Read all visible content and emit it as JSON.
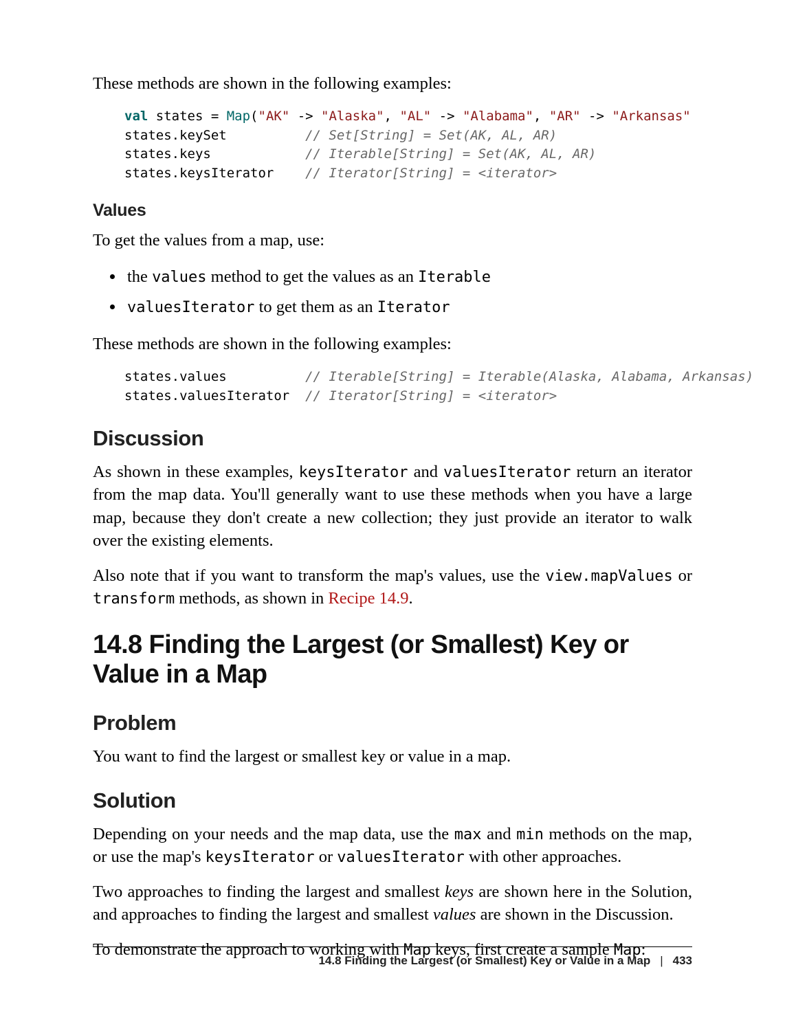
{
  "intro1": "These methods are shown in the following examples:",
  "code1": {
    "l1a": "val",
    "l1b": " states = ",
    "l1c": "Map",
    "l1d": "(",
    "l1s1": "\"AK\"",
    "l1e": " -> ",
    "l1s2": "\"Alaska\"",
    "l1f": ", ",
    "l1s3": "\"AL\"",
    "l1g": " -> ",
    "l1s4": "\"Alabama\"",
    "l1h": ", ",
    "l1s5": "\"AR\"",
    "l1i": " -> ",
    "l1s6": "\"Arkansas\"",
    "l2a": "states.keySet          ",
    "l2c": "// Set[String] = Set(AK, AL, AR)",
    "l3a": "states.keys            ",
    "l3c": "// Iterable[String] = Set(AK, AL, AR)",
    "l4a": "states.keysIterator    ",
    "l4c": "// Iterator[String] = <iterator>"
  },
  "h_values": "Values",
  "values_intro": "To get the values from a map, use:",
  "bullets": {
    "b1a": "the ",
    "b1b": "values",
    "b1c": " method to get the values as an ",
    "b1d": "Iterable",
    "b2a": "valuesIterator",
    "b2b": " to get them as an ",
    "b2c": "Iterator"
  },
  "intro2": "These methods are shown in the following examples:",
  "code2": {
    "l1a": "states.values          ",
    "l1c": "// Iterable[String] = Iterable(Alaska, Alabama, Arkansas)",
    "l2a": "states.valuesIterator  ",
    "l2c": "// Iterator[String] = <iterator>"
  },
  "h_discussion": "Discussion",
  "disc1": {
    "a": "As shown in these examples, ",
    "b": "keysIterator",
    "c": " and ",
    "d": "valuesIterator",
    "e": " return an iterator from the map data. You'll generally want to use these methods when you have a large map, because they don't create a new collection; they just provide an iterator to walk over the existing elements."
  },
  "disc2": {
    "a": "Also note that if you want to transform the map's values, use the ",
    "b": "view.mapValues",
    "c": " or ",
    "d": "transform",
    "e": " methods, as shown in ",
    "f": "Recipe 14.9",
    "g": "."
  },
  "h_148": "14.8 Finding the Largest (or Smallest) Key or Value in a Map",
  "h_problem": "Problem",
  "problem_text": "You want to find the largest or smallest key or value in a map.",
  "h_solution": "Solution",
  "sol1": {
    "a": "Depending on your needs and the map data, use the ",
    "b": "max",
    "c": " and ",
    "d": "min",
    "e": " methods on the map, or use the map's ",
    "f": "keysIterator",
    "g": " or ",
    "h": "valuesIterator",
    "i": " with other approaches."
  },
  "sol2": {
    "a": "Two approaches to finding the largest and smallest ",
    "b": "keys",
    "c": " are shown here in the Solution, and approaches to finding the largest and smallest ",
    "d": "values",
    "e": " are shown in the Discussion."
  },
  "sol3": {
    "a": "To demonstrate the approach to working with ",
    "b": "Map",
    "c": " keys, first create a sample ",
    "d": "Map",
    "e": ":"
  },
  "footer": {
    "title": "14.8 Finding the Largest (or Smallest) Key or Value in a Map",
    "sep": "|",
    "page": "433"
  }
}
